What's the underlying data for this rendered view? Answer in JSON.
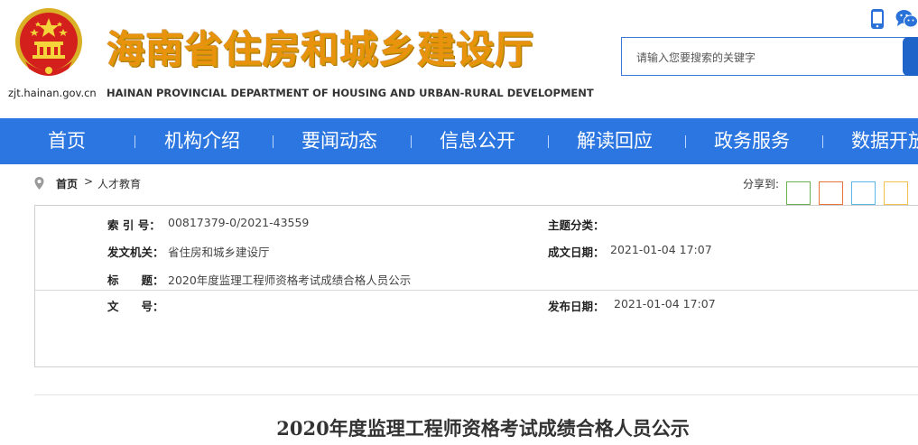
{
  "header": {
    "site_url": "zjt.hainan.gov.cn",
    "site_title": "海南省住房和城乡建设厅",
    "site_subtitle": "HAINAN PROVINCIAL DEPARTMENT OF HOUSING AND URBAN-RURAL DEVELOPMENT",
    "emblem_icon": "national-emblem-icon",
    "phone_icon": "mobile-phone-icon",
    "wechat_icon": "wechat-icon",
    "search": {
      "placeholder": "请输入您要搜索的关键字",
      "value": ""
    }
  },
  "nav": {
    "items": [
      {
        "label": "首页"
      },
      {
        "label": "机构介绍"
      },
      {
        "label": "要闻动态"
      },
      {
        "label": "信息公开"
      },
      {
        "label": "解读回应"
      },
      {
        "label": "政务服务"
      },
      {
        "label": "数据开放"
      }
    ],
    "colors": {
      "background": "#2b76e0",
      "text": "#ffffff"
    }
  },
  "breadcrumb": {
    "home": "首页",
    "separator": ">",
    "current": "人才教育"
  },
  "share": {
    "label": "分享到:",
    "buttons": [
      {
        "name": "share-wechat",
        "color": "#6ab04c"
      },
      {
        "name": "share-weibo",
        "color": "#e8743b"
      },
      {
        "name": "share-qq",
        "color": "#5bb8e6"
      },
      {
        "name": "share-qzone",
        "color": "#f2c14e"
      }
    ]
  },
  "info": {
    "index_label": "索 引 号：",
    "index_value": "00817379-0/2021-43559",
    "topic_label": "主题分类：",
    "topic_value": "",
    "issuer_label": "发文机关：",
    "issuer_value": "省住房和城乡建设厅",
    "created_label": "成文日期：",
    "created_value": "2021-01-04 17:07",
    "title_label": "标　　题：",
    "title_value": "2020年度监理工程师资格考试成绩合格人员公示",
    "docno_label": "文　　号：",
    "docno_value": "",
    "published_label": "发布日期：",
    "published_value": "2021-01-04 17:07"
  },
  "article": {
    "title": "2020年度监理工程师资格考试成绩合格人员公示"
  }
}
